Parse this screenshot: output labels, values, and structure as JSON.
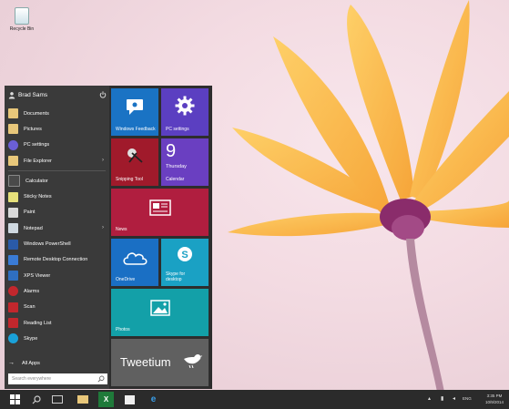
{
  "desktop": {
    "recycle_bin_label": "Recycle Bin"
  },
  "user": {
    "name": "Brad Sams"
  },
  "menu": {
    "items": [
      {
        "label": "Documents",
        "icon": "folder-icon",
        "color": "#e8c77a"
      },
      {
        "label": "Pictures",
        "icon": "folder-icon",
        "color": "#e8c77a"
      },
      {
        "label": "PC settings",
        "icon": "gear-icon",
        "color": "#6b5fd6"
      },
      {
        "label": "File Explorer",
        "icon": "folder-icon",
        "color": "#e8c77a",
        "arrow": true
      },
      {
        "label": "Calculator",
        "icon": "calculator-icon",
        "color": "#4a4a4a"
      },
      {
        "label": "Sticky Notes",
        "icon": "sticky-notes-icon",
        "color": "#e6e07a"
      },
      {
        "label": "Paint",
        "icon": "paint-icon",
        "color": "#d9d9d9"
      },
      {
        "label": "Notepad",
        "icon": "notepad-icon",
        "color": "#cfd8e0",
        "arrow": true
      },
      {
        "label": "Windows PowerShell",
        "icon": "powershell-icon",
        "color": "#2a5aa8"
      },
      {
        "label": "Remote Desktop Connection",
        "icon": "remote-desktop-icon",
        "color": "#3a7bd5"
      },
      {
        "label": "XPS Viewer",
        "icon": "xps-viewer-icon",
        "color": "#2f6fc1"
      },
      {
        "label": "Alarms",
        "icon": "alarm-icon",
        "color": "#c2272d"
      },
      {
        "label": "Scan",
        "icon": "scan-icon",
        "color": "#c2272d"
      },
      {
        "label": "Reading List",
        "icon": "reading-list-icon",
        "color": "#c2272d"
      },
      {
        "label": "Skype",
        "icon": "skype-icon",
        "color": "#1aa1d9"
      }
    ],
    "all_apps": "All Apps",
    "search_placeholder": "Search everywhere"
  },
  "tiles": {
    "feedback": {
      "label": "Windows Feedback",
      "color": "#1a73c4"
    },
    "pc_settings": {
      "label": "PC settings",
      "color": "#5b3fc1"
    },
    "snipping": {
      "label": "Snipping Tool",
      "color": "#a01a2b"
    },
    "calendar": {
      "day": "9",
      "weekday": "Thursday",
      "label": "Calendar",
      "color": "#6a3fc1"
    },
    "news": {
      "label": "News",
      "color": "#b01e3f"
    },
    "onedrive": {
      "label": "OneDrive",
      "color": "#1a6fc4"
    },
    "skype": {
      "label": "Skype for desktop",
      "color": "#1aa1c4"
    },
    "photos": {
      "label": "Photos",
      "color": "#13a0a8"
    },
    "tweetium": {
      "label": "Tweetium",
      "color": "#606060"
    }
  },
  "taskbar": {
    "time": "3:35 PM",
    "date": "10/9/2014",
    "lang": "ENG"
  }
}
